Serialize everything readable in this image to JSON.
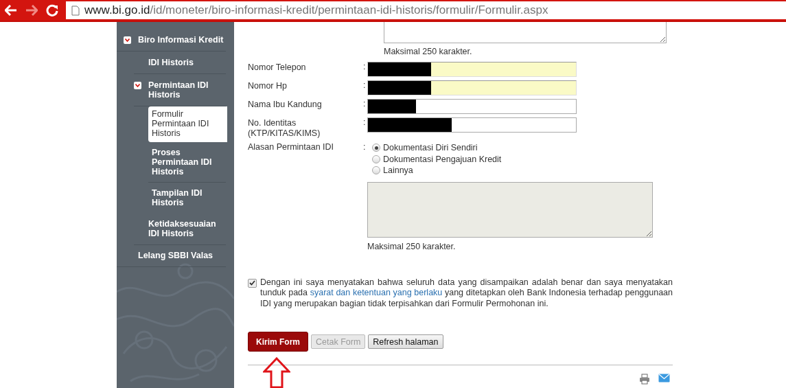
{
  "browser": {
    "back_disabled": false,
    "forward_disabled": true,
    "address": {
      "host": "www.bi.go.id",
      "path": "/id/moneter/biro-informasi-kredit/permintaan-idi-historis/formulir/Formulir.aspx"
    }
  },
  "sidebar": {
    "items": [
      {
        "label": "Biro Informasi Kredit",
        "expanded": true,
        "selected": false,
        "children": [
          {
            "label": "IDI Historis",
            "selected": false
          },
          {
            "label": "Permintaan IDI Historis",
            "expanded": true,
            "selected": false,
            "children": [
              {
                "label": "Formulir Permintaan IDI Historis",
                "selected": true
              },
              {
                "label": "Proses Permintaan IDI Historis",
                "selected": false
              },
              {
                "label": "Tampilan IDI Historis",
                "selected": false
              }
            ]
          },
          {
            "label": "Ketidaksesuaian IDI Historis",
            "selected": false
          }
        ]
      },
      {
        "label": "Lelang SBBI Valas",
        "selected": false
      }
    ]
  },
  "form": {
    "top_hint": "Maksimal 250 karakter.",
    "fields": [
      {
        "label": "Nomor Telepon",
        "separator": ":",
        "autofilled": true,
        "redacted": true
      },
      {
        "label": "Nomor Hp",
        "separator": ":",
        "autofilled": true,
        "redacted": true
      },
      {
        "label": "Nama Ibu Kandung",
        "separator": ":",
        "autofilled": false,
        "redacted": true
      },
      {
        "label": "No. Identitas (KTP/KITAS/KIMS)",
        "separator": ":",
        "autofilled": false,
        "redacted": true
      }
    ],
    "reason": {
      "label": "Alasan Permintaan IDI",
      "separator": ":",
      "options": [
        {
          "label": "Dokumentasi Diri Sendiri",
          "selected": true
        },
        {
          "label": "Dokumentasi Pengajuan Kredit",
          "selected": false
        },
        {
          "label": "Lainnya",
          "selected": false
        }
      ],
      "textarea_disabled": true,
      "hint": "Maksimal 250 karakter."
    },
    "agreement": {
      "checked": true,
      "before": "Dengan ini saya menyatakan bahwa seluruh data yang disampaikan adalah benar dan saya menyatakan tunduk pada",
      "link": "syarat dan ketentuan yang berlaku",
      "after": "yang ditetapkan oleh Bank Indonesia terhadap penggunaan IDI yang merupakan bagian tidak terpisahkan dari Formulir Permohonan ini."
    },
    "buttons": [
      {
        "label": "Kirim Form",
        "kind": "primary",
        "disabled": false
      },
      {
        "label": "Cetak Form",
        "kind": "normal",
        "disabled": true
      },
      {
        "label": "Refresh halaman",
        "kind": "normal",
        "disabled": false
      }
    ]
  },
  "annotation": {
    "arrow": true
  }
}
